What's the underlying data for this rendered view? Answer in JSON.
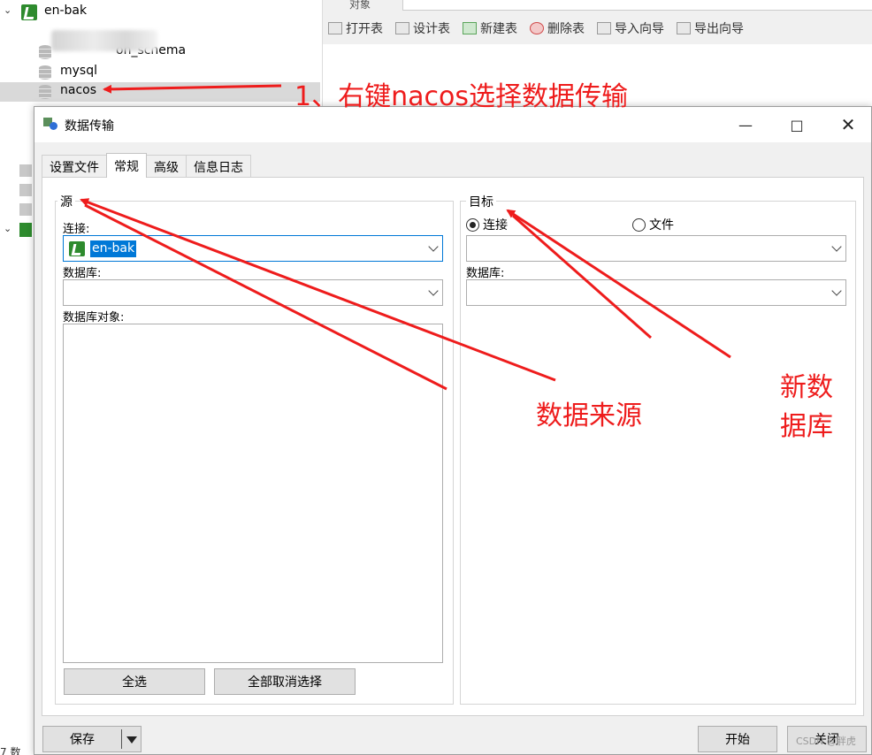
{
  "tree": {
    "connection": "en-bak",
    "databases": [
      "information_schema",
      "mysql",
      "nacos"
    ],
    "blurred_label_visible": "on_schema",
    "selected": "nacos"
  },
  "toolbar": {
    "tab_hint": "对象",
    "buttons": [
      "打开表",
      "设计表",
      "新建表",
      "删除表",
      "导入向导",
      "导出向导"
    ]
  },
  "dialog": {
    "title": "数据传输",
    "tabs": [
      "设置文件",
      "常规",
      "高级",
      "信息日志"
    ],
    "active_tab": "常规",
    "source": {
      "title": "源",
      "connection_label": "连接:",
      "connection_value": "en-bak",
      "database_label": "数据库:",
      "database_value": "",
      "objects_label": "数据库对象:",
      "select_all": "全选",
      "deselect_all": "全部取消选择"
    },
    "target": {
      "title": "目标",
      "radio_connection": "连接",
      "radio_file": "文件",
      "selected_radio": "连接",
      "database_label": "数据库:"
    },
    "footer": {
      "save": "保存",
      "start": "开始",
      "close": "关闭"
    }
  },
  "annotations": {
    "step1": "1、右键nacos选择数据传输",
    "source_note": "数据来源",
    "target_note_line1": "新数",
    "target_note_line2": "据库",
    "color": "#ee1c1c"
  },
  "watermark": "CSDN @胖虎",
  "status_text": "7 数"
}
